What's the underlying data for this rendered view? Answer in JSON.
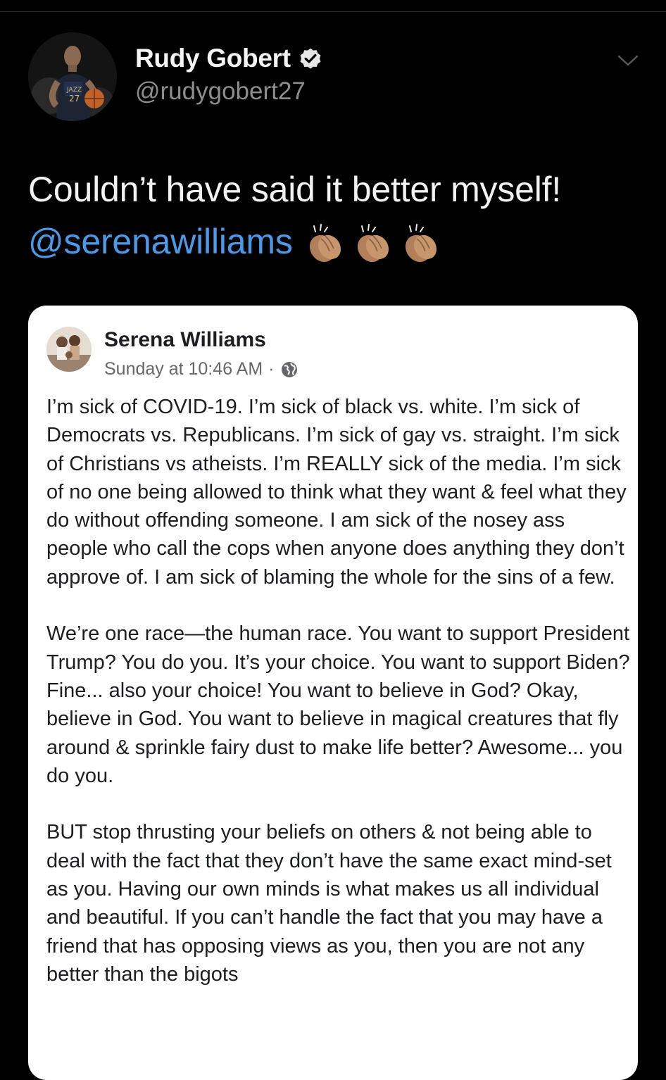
{
  "tweet": {
    "display_name": "Rudy Gobert",
    "handle": "@rudygobert27",
    "text": "Couldn’t have said it better myself!",
    "mention": "@serenawilliams"
  },
  "icons": {
    "verified": "verified-badge-icon",
    "menu": "chevron-down-icon",
    "claps": [
      "clapping-hands-icon",
      "clapping-hands-icon",
      "clapping-hands-icon"
    ],
    "globe": "globe-icon"
  },
  "colors": {
    "background": "#000000",
    "mention": "#4a9ae8",
    "card": "#ffffff",
    "meta": "#65676b"
  },
  "embedded_post": {
    "author": "Serena Williams",
    "timestamp": "Sunday at 10:46 AM",
    "separator": "·",
    "paragraphs": [
      "I’m sick of COVID-19. I’m sick of black vs. white. I’m sick of Democrats vs. Republicans. I’m sick of gay vs. straight. I’m sick of Christians vs atheists. I’m REALLY sick of the media. I’m sick of no one being allowed to think what they want & feel what they do without offending someone. I am sick of the nosey ass people who call the cops when anyone does anything they don’t approve of. I am sick of blaming the whole for the sins of a few.",
      "We’re one race—the human race. You want to support President Trump? You do you. It’s your choice. You want to support Biden? Fine... also your choice! You want to believe in God? Okay, believe in God. You want to believe in magical creatures that fly around & sprinkle fairy dust to make life better? Awesome... you do you.",
      "BUT stop thrusting your beliefs on others & not being able to deal with the fact that they don’t have the same exact mind-set as you. Having our own minds is what makes us all individual and beautiful. If you can’t handle the fact that you may have a friend that has opposing views as you, then you are not any better than the bigots"
    ]
  }
}
